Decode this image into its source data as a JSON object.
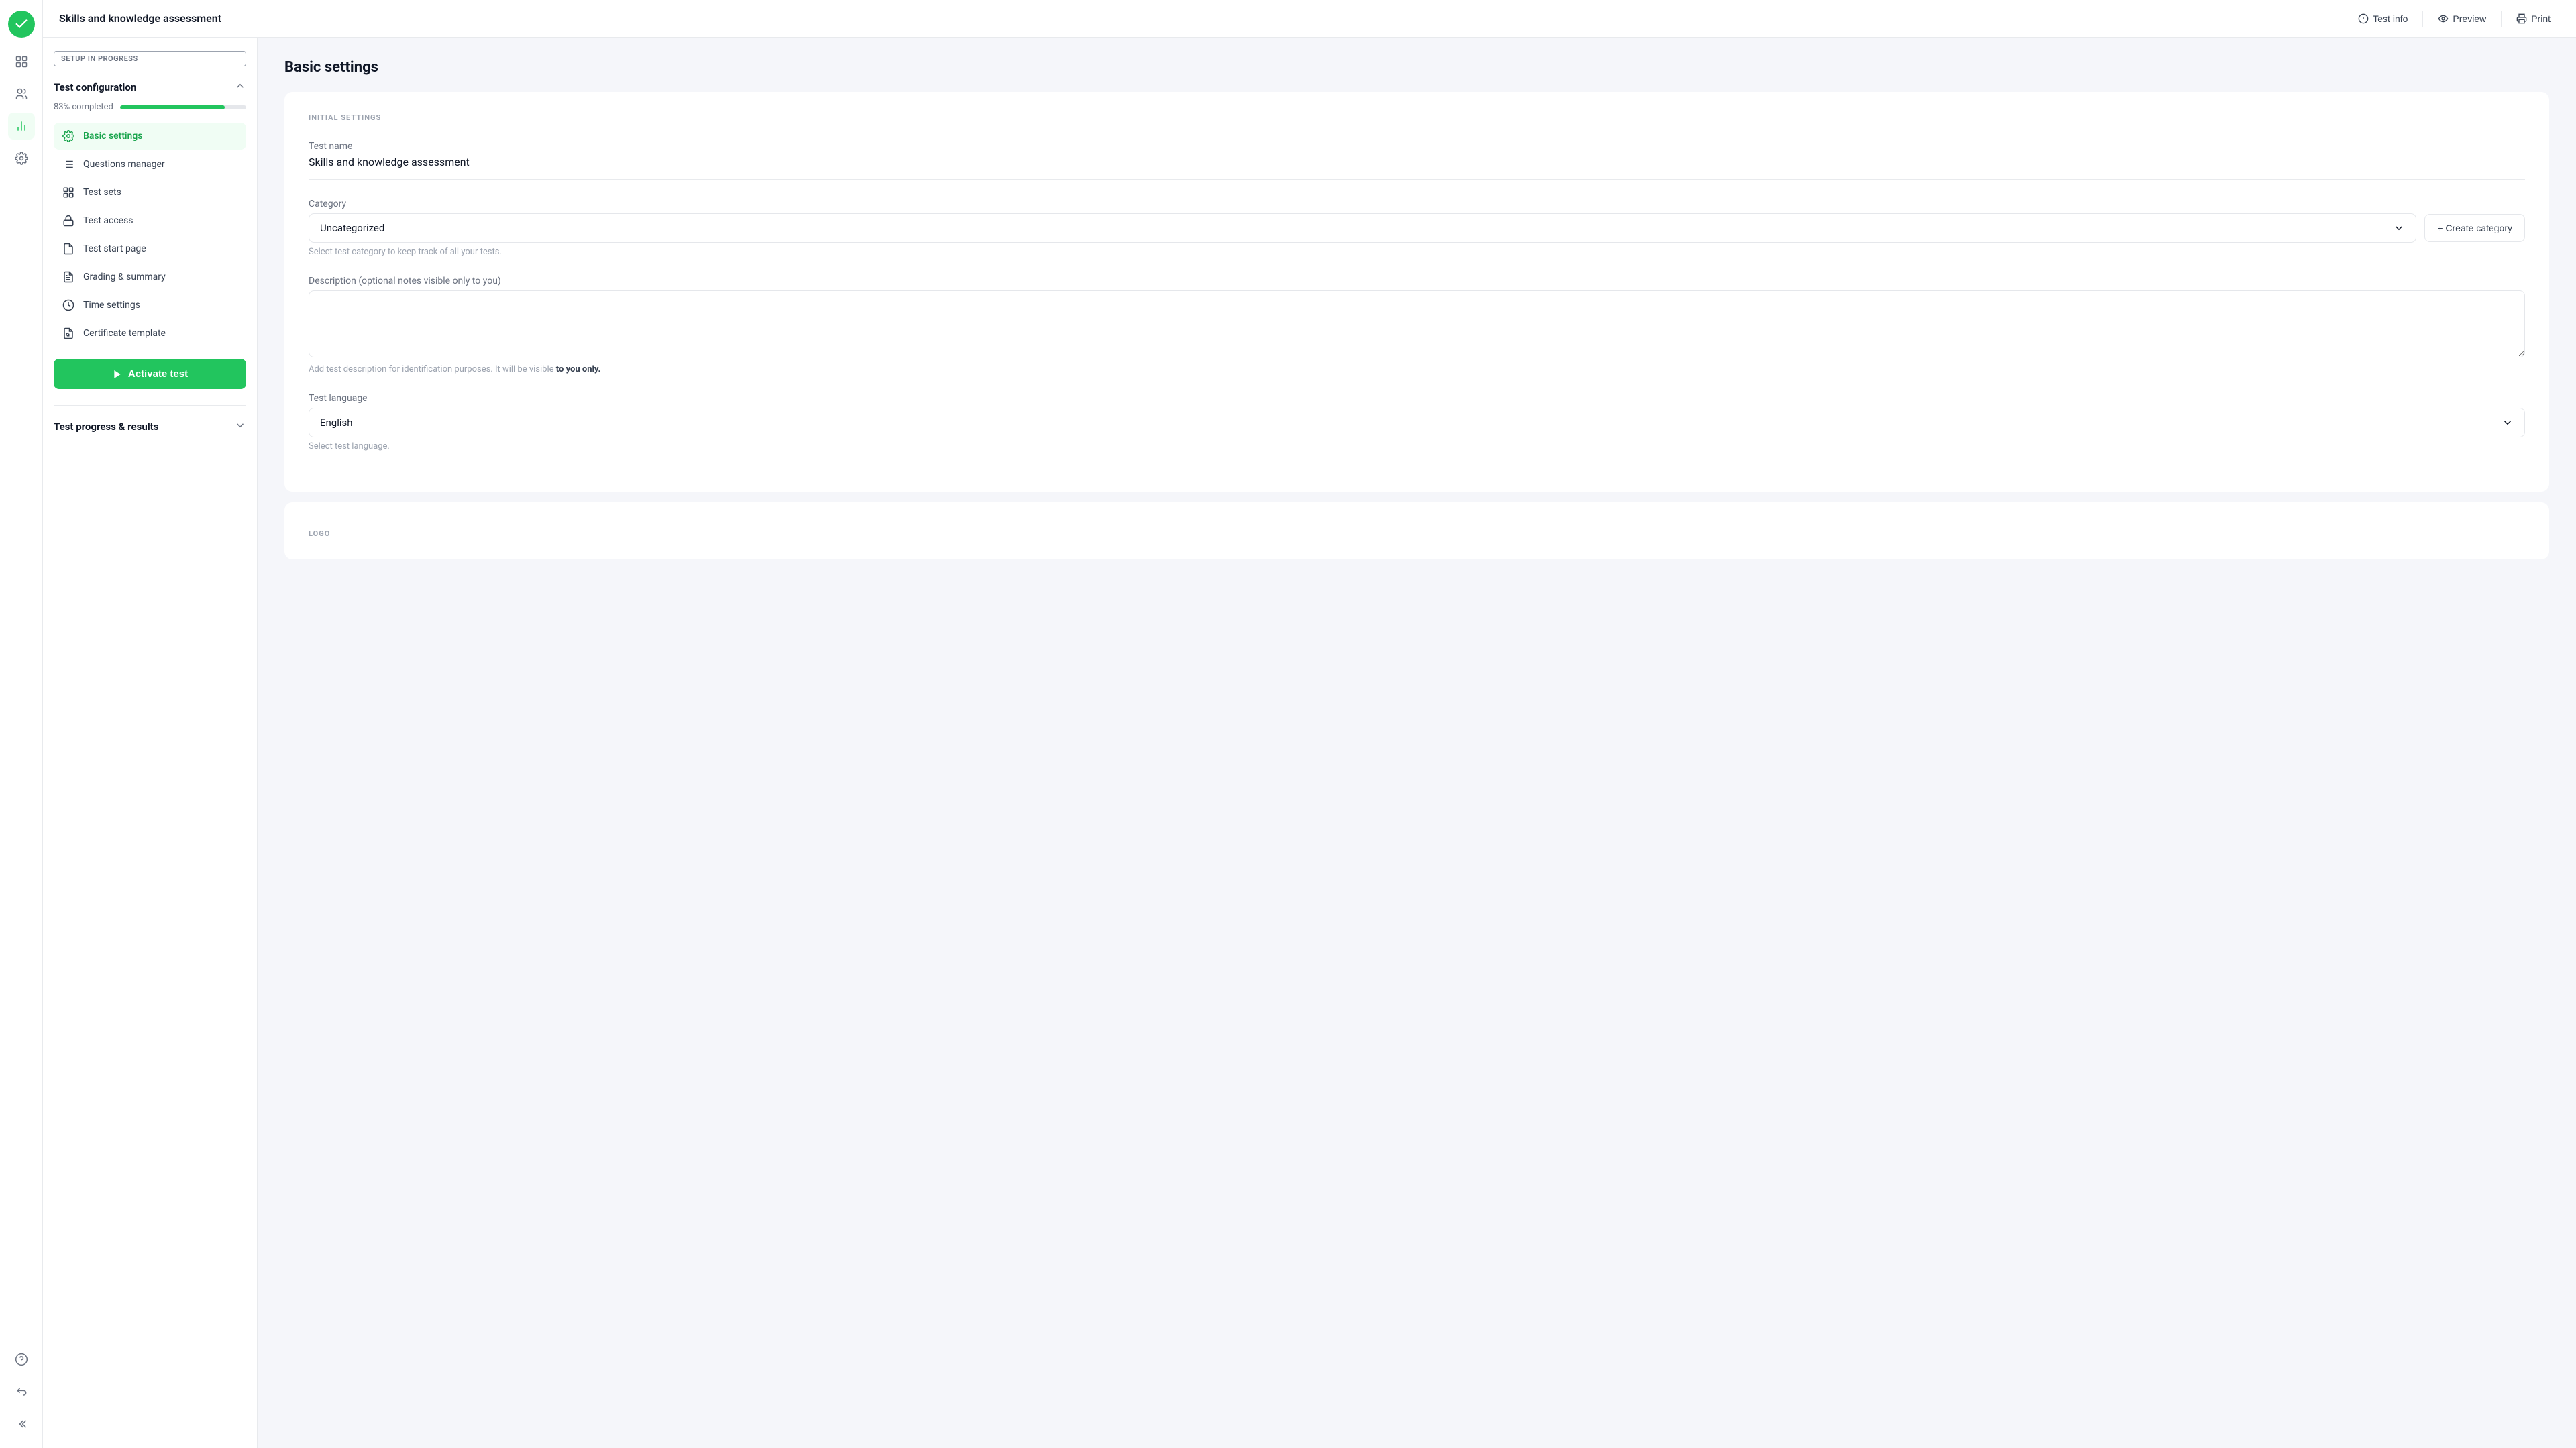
{
  "app": {
    "title": "Skills and knowledge assessment"
  },
  "header": {
    "title": "Skills and knowledge assessment",
    "actions": [
      {
        "id": "test-info",
        "label": "Test info",
        "icon": "info-icon"
      },
      {
        "id": "preview",
        "label": "Preview",
        "icon": "preview-icon"
      },
      {
        "id": "print",
        "label": "Print",
        "icon": "print-icon"
      }
    ]
  },
  "sidebar": {
    "icons": [
      {
        "id": "dashboard",
        "icon": "grid-icon"
      },
      {
        "id": "users",
        "icon": "users-icon"
      },
      {
        "id": "analytics",
        "icon": "chart-icon"
      },
      {
        "id": "settings",
        "icon": "settings-icon"
      }
    ],
    "bottom_icons": [
      {
        "id": "help",
        "icon": "help-icon"
      },
      {
        "id": "back",
        "icon": "back-icon"
      },
      {
        "id": "collapse",
        "icon": "collapse-icon"
      }
    ]
  },
  "config_panel": {
    "setup_badge": "SETUP IN PROGRESS",
    "section_title": "Test configuration",
    "progress_label": "83% completed",
    "progress_percent": 83,
    "nav_items": [
      {
        "id": "basic-settings",
        "label": "Basic settings",
        "active": true
      },
      {
        "id": "questions-manager",
        "label": "Questions manager",
        "active": false
      },
      {
        "id": "test-sets",
        "label": "Test sets",
        "active": false
      },
      {
        "id": "test-access",
        "label": "Test access",
        "active": false
      },
      {
        "id": "test-start-page",
        "label": "Test start page",
        "active": false
      },
      {
        "id": "grading-summary",
        "label": "Grading & summary",
        "active": false
      },
      {
        "id": "time-settings",
        "label": "Time settings",
        "active": false
      },
      {
        "id": "certificate-template",
        "label": "Certificate template",
        "active": false
      }
    ],
    "activate_btn": "Activate test",
    "section2_title": "Test progress & results"
  },
  "main": {
    "heading": "Basic settings",
    "initial_settings_label": "INITIAL SETTINGS",
    "test_name_label": "Test name",
    "test_name_value": "Skills and knowledge assessment",
    "category_label": "Category",
    "category_value": "Uncategorized",
    "category_hint": "Select test category to keep track of all your tests.",
    "create_category_btn": "+ Create category",
    "description_label": "Description (optional notes visible only to you)",
    "description_placeholder": "",
    "description_hint_prefix": "Add test description for identification purposes. It will be visible ",
    "description_hint_bold": "to you only.",
    "test_language_label": "Test language",
    "test_language_value": "English",
    "test_language_hint": "Select test language.",
    "logo_label": "LOGO"
  }
}
